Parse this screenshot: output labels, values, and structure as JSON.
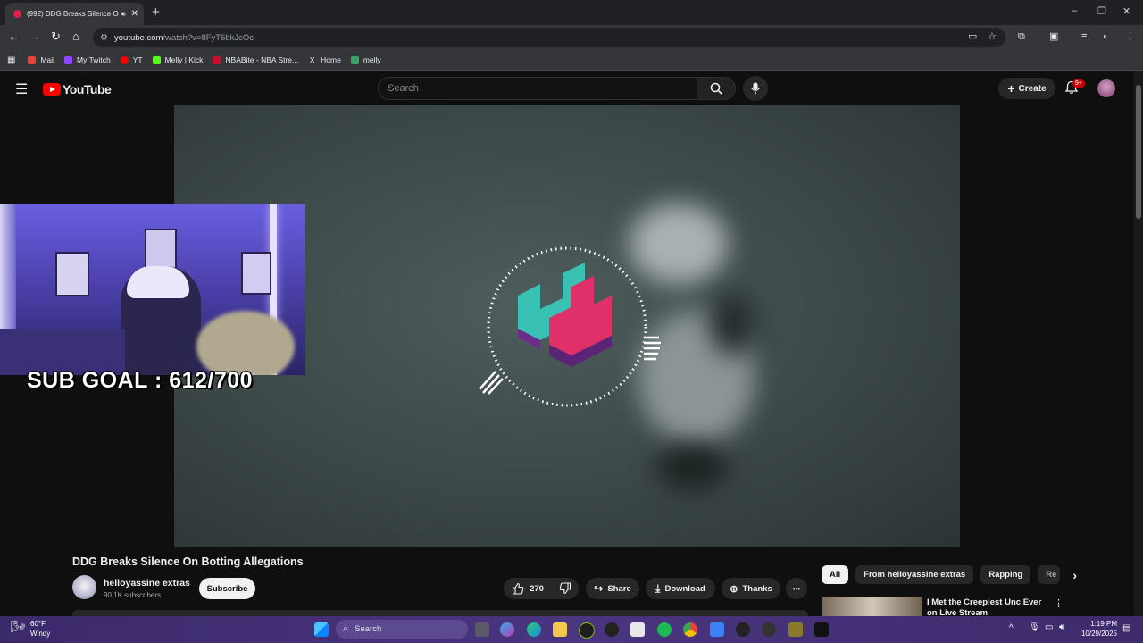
{
  "browser": {
    "tab_title": "(992) DDG Breaks Silence O",
    "tab_close": "✕",
    "new_tab": "+",
    "window_controls": [
      "–",
      "❐",
      "✕"
    ],
    "url_domain": "youtube.com",
    "url_path": "/watch?v=8FyT6bkJcOc",
    "bookmarks": [
      {
        "label": "Mail",
        "icon": "gmail-icon",
        "color": "#ea4335"
      },
      {
        "label": "My Twitch",
        "icon": "twitch-icon",
        "color": "#9146ff"
      },
      {
        "label": "YT",
        "icon": "youtube-icon",
        "color": "#ff0000"
      },
      {
        "label": "Melly | Kick",
        "icon": "kick-icon",
        "color": "#53fc18"
      },
      {
        "label": "NBABite - NBA Stre...",
        "icon": "nba-icon",
        "color": "#c8102e"
      },
      {
        "label": "Home",
        "icon": "x-icon",
        "color": "#ffffff"
      },
      {
        "label": "melly",
        "icon": "leaf-icon",
        "color": "#3ea36b"
      }
    ]
  },
  "youtube": {
    "logo_text": "YouTube",
    "search_placeholder": "Search",
    "create_label": "Create",
    "notification_badge": "9+"
  },
  "overlay": {
    "sub_goal": "SUB GOAL : 612/700"
  },
  "video": {
    "title": "DDG Breaks Silence On Botting Allegations",
    "channel_name": "helloyassine extras",
    "channel_subs": "90.1K subscribers",
    "subscribe_label": "Subscribe",
    "likes": "270",
    "share_label": "Share",
    "download_label": "Download",
    "thanks_label": "Thanks",
    "more_label": "•••"
  },
  "sidebar": {
    "chips": [
      "All",
      "From helloyassine extras",
      "Rapping",
      "Re"
    ],
    "selected_chip": "All",
    "rec_title": "I Met the Creepiest Unc Ever on Live Stream"
  },
  "taskbar": {
    "weather_temp": "60°F",
    "weather_desc": "Windy",
    "search_label": "Search",
    "time": "1:19 PM",
    "date": "10/29/2025"
  }
}
